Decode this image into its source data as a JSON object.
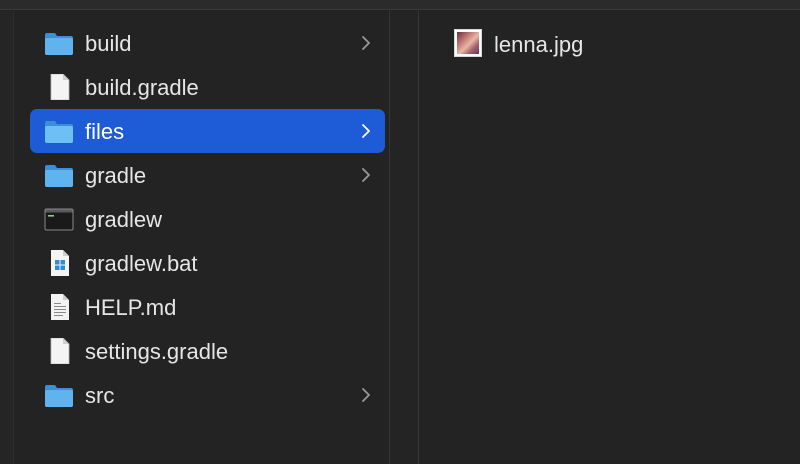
{
  "column1": {
    "items": [
      {
        "label": "build",
        "icon": "folder-icon",
        "has_children": true,
        "selected": false
      },
      {
        "label": "build.gradle",
        "icon": "document-icon",
        "has_children": false,
        "selected": false
      },
      {
        "label": "files",
        "icon": "folder-icon",
        "has_children": true,
        "selected": true
      },
      {
        "label": "gradle",
        "icon": "folder-icon",
        "has_children": true,
        "selected": false
      },
      {
        "label": "gradlew",
        "icon": "terminal-icon",
        "has_children": false,
        "selected": false
      },
      {
        "label": "gradlew.bat",
        "icon": "windows-document-icon",
        "has_children": false,
        "selected": false
      },
      {
        "label": "HELP.md",
        "icon": "text-document-icon",
        "has_children": false,
        "selected": false
      },
      {
        "label": "settings.gradle",
        "icon": "document-icon",
        "has_children": false,
        "selected": false
      },
      {
        "label": "src",
        "icon": "folder-icon",
        "has_children": true,
        "selected": false
      }
    ]
  },
  "column2": {
    "items": [
      {
        "label": "lenna.jpg",
        "icon": "image-thumbnail-icon"
      }
    ]
  },
  "colors": {
    "background": "#232323",
    "selection": "#1e5bd6",
    "folder": "#4aa3e8",
    "text": "#e6e6e6"
  }
}
